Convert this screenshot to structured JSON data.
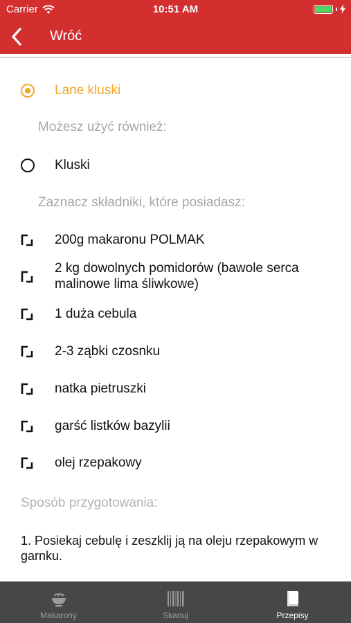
{
  "status_bar": {
    "carrier": "Carrier",
    "time": "10:51 AM",
    "wifi_icon": "wifi-icon",
    "battery_icon": "battery-icon",
    "charging_icon": "charging-bolt-icon"
  },
  "navbar": {
    "back_label": "Wróć",
    "back_icon": "chevron-left-icon",
    "color": "#d32f2f"
  },
  "main": {
    "selected_option": "Lane kluski",
    "alternatives_label": "Możesz użyć również:",
    "alternative_option": "Kluski",
    "ingredients_label": "Zaznacz składniki, które posiadasz:",
    "ingredients": [
      "200g makaronu POLMAK",
      "2 kg dowolnych pomidorów (bawole serca malinowe lima śliwkowe)",
      "1 duża cebula",
      "2-3 ząbki czosnku",
      "natka pietruszki",
      "garść listków bazylii",
      "olej rzepakowy"
    ],
    "preparation_label": "Sposób przygotowania:",
    "preparation_text": "1. Posiekaj cebulę i zeszklij ją na oleju rzepakowym w garnku.",
    "accent_color": "#f5a623"
  },
  "tabbar": {
    "tabs": [
      {
        "label": "Makarony",
        "icon": "pasta-bowl-icon",
        "active": false
      },
      {
        "label": "Skanuj",
        "icon": "barcode-icon",
        "active": false
      },
      {
        "label": "Przepisy",
        "icon": "book-icon",
        "active": true
      }
    ]
  }
}
